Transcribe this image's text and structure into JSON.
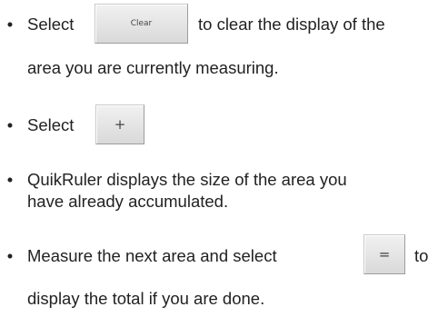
{
  "bullet_char": "•",
  "steps": [
    {
      "prefix": "Select",
      "button_label": "Clear",
      "suffix": "to clear the display of the",
      "continuation": "area you are currently measuring."
    },
    {
      "prefix": "Select",
      "button_label": "+"
    },
    {
      "line1": "QuikRuler displays the size of the area you",
      "line2": "have already accumulated."
    },
    {
      "prefix": "Measure the next area and select",
      "button_label": "=",
      "suffix": "to",
      "continuation": "display the total if you are done."
    }
  ]
}
